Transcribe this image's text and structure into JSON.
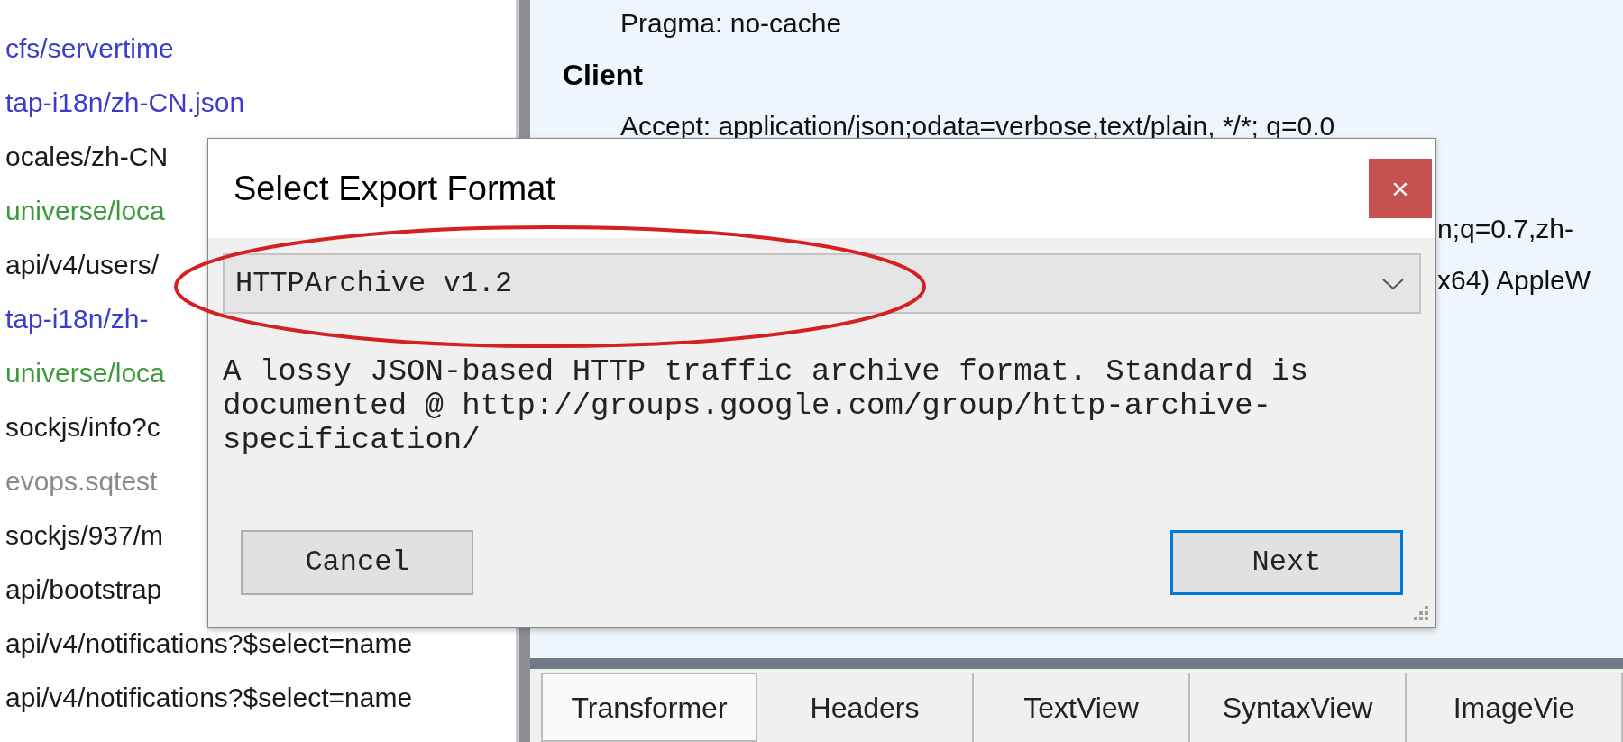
{
  "session_list": [
    {
      "text": "cfs/servertime",
      "color": "#3c3ccc"
    },
    {
      "text": "tap-i18n/zh-CN.json",
      "color": "#3c3ccc"
    },
    {
      "text": "ocales/zh-CN",
      "color": "#1a1a1a"
    },
    {
      "text": "universe/loca",
      "color": "#3c9a3c"
    },
    {
      "text": "api/v4/users/",
      "color": "#1a1a1a"
    },
    {
      "text": "tap-i18n/zh-",
      "color": "#3c3ccc"
    },
    {
      "text": "universe/loca",
      "color": "#3c9a3c"
    },
    {
      "text": "sockjs/info?c",
      "color": "#1a1a1a"
    },
    {
      "text": "evops.sqtest",
      "color": "#8a8a8a"
    },
    {
      "text": "sockjs/937/m",
      "color": "#1a1a1a"
    },
    {
      "text": "api/bootstrap",
      "color": "#1a1a1a"
    },
    {
      "text": "api/v4/notifications?$select=name",
      "color": "#1a1a1a"
    },
    {
      "text": "api/v4/notifications?$select=name",
      "color": "#1a1a1a"
    }
  ],
  "headers_view": {
    "lines": [
      {
        "kind": "header",
        "text": "Pragma: no-cache"
      },
      {
        "kind": "group",
        "text": "Client"
      },
      {
        "kind": "header",
        "text": "Accept: application/json;odata=verbose,text/plain, */*; q=0.0"
      },
      {
        "kind": "hidden"
      },
      {
        "kind": "tail",
        "text": "n;q=0.7,zh-"
      },
      {
        "kind": "tail",
        "text": "x64) AppleW"
      }
    ]
  },
  "inspector_tabs": [
    {
      "label": "Transformer",
      "selected": true
    },
    {
      "label": "Headers",
      "selected": false
    },
    {
      "label": "TextView",
      "selected": false
    },
    {
      "label": "SyntaxView",
      "selected": false
    },
    {
      "label": "ImageVie",
      "selected": false
    }
  ],
  "dialog": {
    "title": "Select Export Format",
    "close": "×",
    "format_select": {
      "value": "HTTPArchive v1.2"
    },
    "description": "A lossy JSON-based HTTP traffic archive format. Standard is documented @ http://groups.google.com/group/http-archive-specification/",
    "buttons": [
      {
        "label": "Cancel",
        "default": false
      },
      {
        "label": "Next",
        "default": true
      }
    ]
  },
  "annotation": {
    "kind": "ellipse",
    "color": "#d42020"
  }
}
